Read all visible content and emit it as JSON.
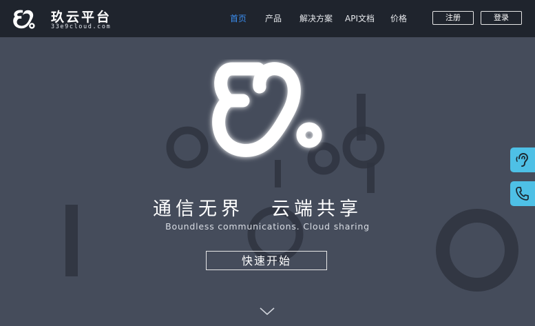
{
  "brand": {
    "title": "玖云平台",
    "subtitle": "33e9cloud.com"
  },
  "nav": {
    "items": [
      {
        "label": "首页",
        "active": true
      },
      {
        "label": "产品",
        "active": false
      },
      {
        "label": "解决方案",
        "active": false
      },
      {
        "label": "API文档",
        "active": false
      },
      {
        "label": "价格",
        "active": false
      }
    ],
    "register_label": "注册",
    "login_label": "登录"
  },
  "hero": {
    "slogan_left": "通信无界",
    "slogan_right": "云端共享",
    "subslogan": "Boundless communications. Cloud sharing",
    "cta_label": "快速开始"
  },
  "side_tools": [
    {
      "icon": "ear-service-icon"
    },
    {
      "icon": "phone-icon"
    }
  ],
  "colors": {
    "navbar_bg": "#1f242d",
    "hero_bg": "#454c5b",
    "active_nav": "#3b8ef0",
    "side_button": "#4ec0e6"
  }
}
